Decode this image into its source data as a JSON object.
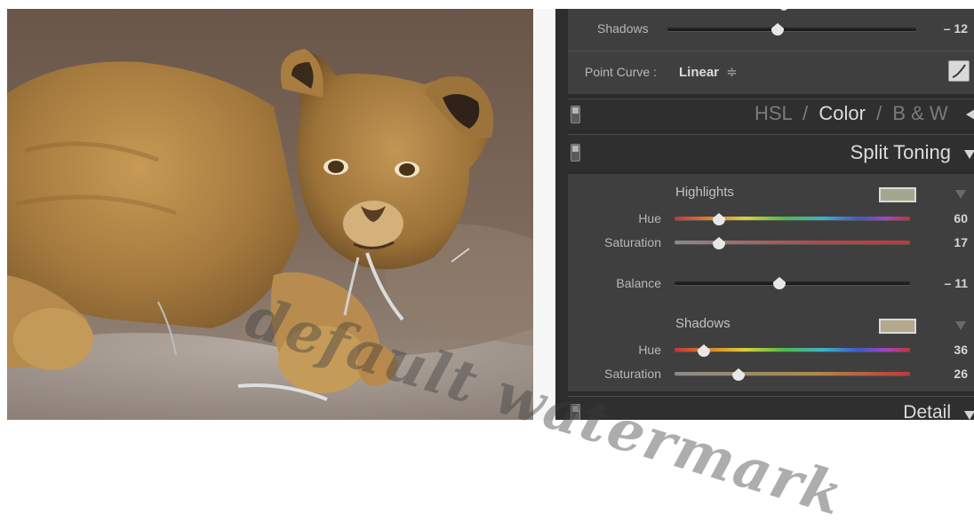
{
  "basic": {
    "shadows_label": "Shadows",
    "shadows_value": "– 12",
    "point_curve_label": "Point Curve :",
    "point_curve_value": "Linear",
    "point_curve_arrow": "≑"
  },
  "hsl_header": {
    "hsl": "HSL",
    "slash1": "/",
    "color": "Color",
    "slash2": "/",
    "bw": "B & W"
  },
  "split_toning": {
    "title": "Split Toning",
    "highlights": {
      "label": "Highlights",
      "swatch_color": "#a3a88d",
      "hue_label": "Hue",
      "hue_value": "60",
      "saturation_label": "Saturation",
      "saturation_value": "17"
    },
    "balance": {
      "label": "Balance",
      "value": "– 11"
    },
    "shadows": {
      "label": "Shadows",
      "swatch_color": "#b4a98b",
      "hue_label": "Hue",
      "hue_value": "36",
      "saturation_label": "Saturation",
      "saturation_value": "26"
    }
  },
  "detail": {
    "title": "Detail"
  },
  "watermark": "default watermark",
  "colors": {
    "panel_bg": "#3f3f3f",
    "header_bg": "#2f2f2f",
    "text": "#c9c9c9"
  }
}
